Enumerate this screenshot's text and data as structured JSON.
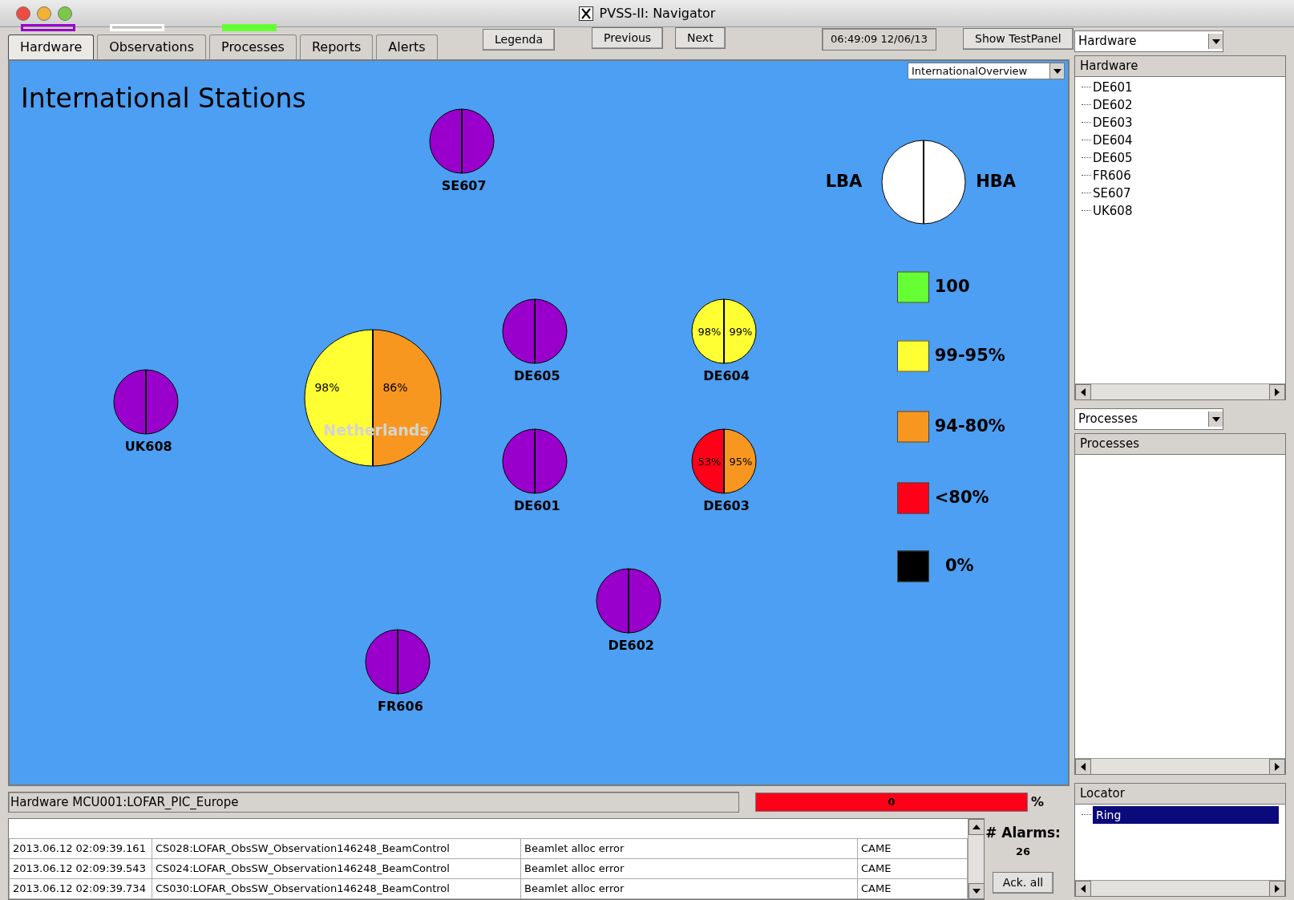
{
  "window": {
    "title": "PVSS-II: Navigator"
  },
  "tabs": [
    {
      "label": "Hardware",
      "selected": true,
      "filled": false,
      "color": "#9900cc"
    },
    {
      "label": "Observations",
      "selected": false,
      "filled": false,
      "color": "#ffffff"
    },
    {
      "label": "Processes",
      "selected": false,
      "filled": true,
      "color": "#66ff33"
    },
    {
      "label": "Reports",
      "selected": false
    },
    {
      "label": "Alerts",
      "selected": false
    }
  ],
  "toolbar": {
    "legend_button": "Legenda",
    "previous_button": "Previous",
    "next_button": "Next",
    "clock": "06:49:09  12/06/13",
    "testpanel_button": "Show TestPanel"
  },
  "view_select": {
    "value": "InternationalOverview"
  },
  "map": {
    "title": "International Stations",
    "stations": [
      {
        "name": "SE607",
        "kind": "station",
        "lba": {
          "color": "#9900cc"
        },
        "hba": {
          "color": "#9900cc"
        }
      },
      {
        "name": "UK608",
        "kind": "station",
        "lba": {
          "color": "#9900cc"
        },
        "hba": {
          "color": "#9900cc"
        }
      },
      {
        "name": "Netherlands",
        "kind": "country",
        "lba": {
          "color": "#ffff33",
          "reading": "98%"
        },
        "hba": {
          "color": "#f7971f",
          "reading": "86%"
        }
      },
      {
        "name": "DE605",
        "kind": "station",
        "lba": {
          "color": "#9900cc"
        },
        "hba": {
          "color": "#9900cc"
        }
      },
      {
        "name": "DE604",
        "kind": "station",
        "lba": {
          "color": "#ffff33",
          "reading": "98%"
        },
        "hba": {
          "color": "#ffff33",
          "reading": "99%"
        }
      },
      {
        "name": "DE601",
        "kind": "station",
        "lba": {
          "color": "#9900cc"
        },
        "hba": {
          "color": "#9900cc"
        }
      },
      {
        "name": "DE603",
        "kind": "station",
        "lba": {
          "color": "#ff0019",
          "reading": "53%"
        },
        "hba": {
          "color": "#f7971f",
          "reading": "95%"
        }
      },
      {
        "name": "DE602",
        "kind": "station",
        "lba": {
          "color": "#9900cc"
        },
        "hba": {
          "color": "#9900cc"
        }
      },
      {
        "name": "FR606",
        "kind": "station",
        "lba": {
          "color": "#9900cc"
        },
        "hba": {
          "color": "#9900cc"
        }
      }
    ],
    "legend": {
      "lba_label": "LBA",
      "hba_label": "HBA",
      "entries": [
        {
          "label": "100",
          "color": "#66ff33"
        },
        {
          "label": "99-95%",
          "color": "#ffff33"
        },
        {
          "label": "94-80%",
          "color": "#f7971f"
        },
        {
          "label": "<80%",
          "color": "#ff0019"
        },
        {
          "label": "0%",
          "color": "#000000"
        }
      ]
    }
  },
  "status": {
    "path": "Hardware MCU001:LOFAR_PIC_Europe",
    "progress_value": "0",
    "progress_unit": "%"
  },
  "alarms": {
    "rows": [
      {
        "time": "2013.06.12 02:09:39.161",
        "source": "CS028:LOFAR_ObsSW_Observation146248_BeamControl",
        "message": "Beamlet alloc error",
        "state": "CAME"
      },
      {
        "time": "2013.06.12 02:09:39.543",
        "source": "CS024:LOFAR_ObsSW_Observation146248_BeamControl",
        "message": "Beamlet alloc error",
        "state": "CAME"
      },
      {
        "time": "2013.06.12 02:09:39.734",
        "source": "CS030:LOFAR_ObsSW_Observation146248_BeamControl",
        "message": "Beamlet alloc error",
        "state": "CAME"
      }
    ],
    "count_label": "# Alarms:",
    "count": "26",
    "ack_button": "Ack. all"
  },
  "sidebar": {
    "hardware_select": "Hardware",
    "hardware_header": "Hardware",
    "hardware_items": [
      {
        "label": "DE601"
      },
      {
        "label": "DE602"
      },
      {
        "label": "DE603"
      },
      {
        "label": "DE604"
      },
      {
        "label": "DE605"
      },
      {
        "label": "FR606"
      },
      {
        "label": "SE607"
      },
      {
        "label": "UK608"
      }
    ],
    "processes_select": "Processes",
    "processes_header": "Processes",
    "locator_header": "Locator",
    "locator_items": [
      {
        "label": "Ring",
        "selected": true
      }
    ]
  }
}
